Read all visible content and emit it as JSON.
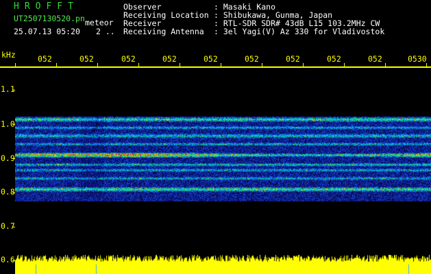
{
  "header": {
    "brand": "HROFFT",
    "file_name": "UT2507130520.pn",
    "mode": "meteor",
    "date_time": "25.07.13 05:20",
    "extra": "2 ..",
    "info": [
      {
        "label": "Observer",
        "value": ": Masaki Kano"
      },
      {
        "label": "Receiving Location",
        "value": ": Shibukawa, Gunma, Japan"
      },
      {
        "label": "Receiver",
        "value": ": RTL-SDR SDR# 43dB L15 103.2MHz CW"
      },
      {
        "label": "Receiving Antenna",
        "value": ": 3el Yagi(V) Az 330 for Vladivostok"
      }
    ]
  },
  "freq_axis": {
    "unit": "kHz",
    "labels": [
      "1.1",
      "1.0",
      "0.9",
      "0.8",
      "0.7",
      "0.6"
    ]
  },
  "time_axis": {
    "labels": [
      "052",
      "052",
      "052",
      "052",
      "052",
      "052",
      "052",
      "052",
      "052",
      "0530"
    ]
  },
  "colors": {
    "axis": "#ffff00",
    "brand": "#33dd33",
    "text": "#ffffff",
    "filename": "#55e655",
    "noise_floor": "#0a1070"
  }
}
